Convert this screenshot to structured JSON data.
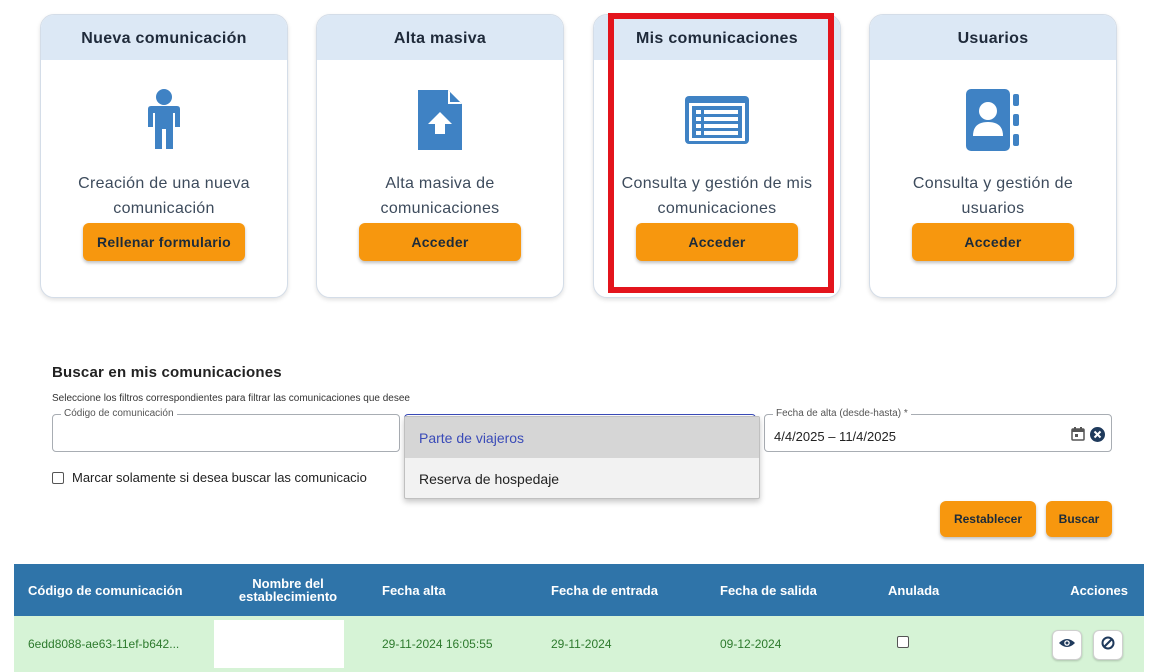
{
  "cards": [
    {
      "title": "Nueva comunicación",
      "icon": "person-icon",
      "description": "Creación de una nueva comunicación",
      "button": "Rellenar formulario"
    },
    {
      "title": "Alta masiva",
      "icon": "file-upload-icon",
      "description": "Alta masiva de comunicaciones",
      "button": "Acceder"
    },
    {
      "title": "Mis comunicaciones",
      "icon": "list-icon",
      "description": "Consulta y gestión de mis comunicaciones",
      "button": "Acceder"
    },
    {
      "title": "Usuarios",
      "icon": "contacts-icon",
      "description": "Consulta y gestión de usuarios",
      "button": "Acceder"
    }
  ],
  "search": {
    "title": "Buscar en mis comunicaciones",
    "subtitle": "Seleccione los filtros correspondientes para filtrar las comunicaciones que desee",
    "code_label": "Código de comunicación",
    "code_value": "",
    "date_label": "Fecha de alta (desde-hasta) *",
    "date_value": "4/4/2025 – 11/4/2025",
    "checkbox_label": "Marcar solamente si desea buscar las comunicacio",
    "dropdown_options": [
      "Parte de viajeros",
      "Reserva de hospedaje"
    ],
    "dropdown_selected": "Parte de viajeros",
    "reset_button": "Restablecer",
    "search_button": "Buscar"
  },
  "table": {
    "columns": [
      "Código de comunicación",
      "Nombre del establecimiento",
      "Fecha alta",
      "Fecha de entrada",
      "Fecha de salida",
      "Anulada",
      "Acciones"
    ],
    "rows": [
      {
        "code": "6edd8088-ae63-11ef-b642...",
        "name": "",
        "created": "29-11-2024 16:05:55",
        "entry": "29-11-2024",
        "exit": "09-12-2024",
        "cancelled": false
      }
    ]
  },
  "colors": {
    "accent": "#f7970e",
    "header_blue": "#2f74a9",
    "card_head": "#dce8f5",
    "icon_blue": "#3f82c4",
    "highlight": "#e3141c",
    "row_green": "#d6f3d6"
  }
}
